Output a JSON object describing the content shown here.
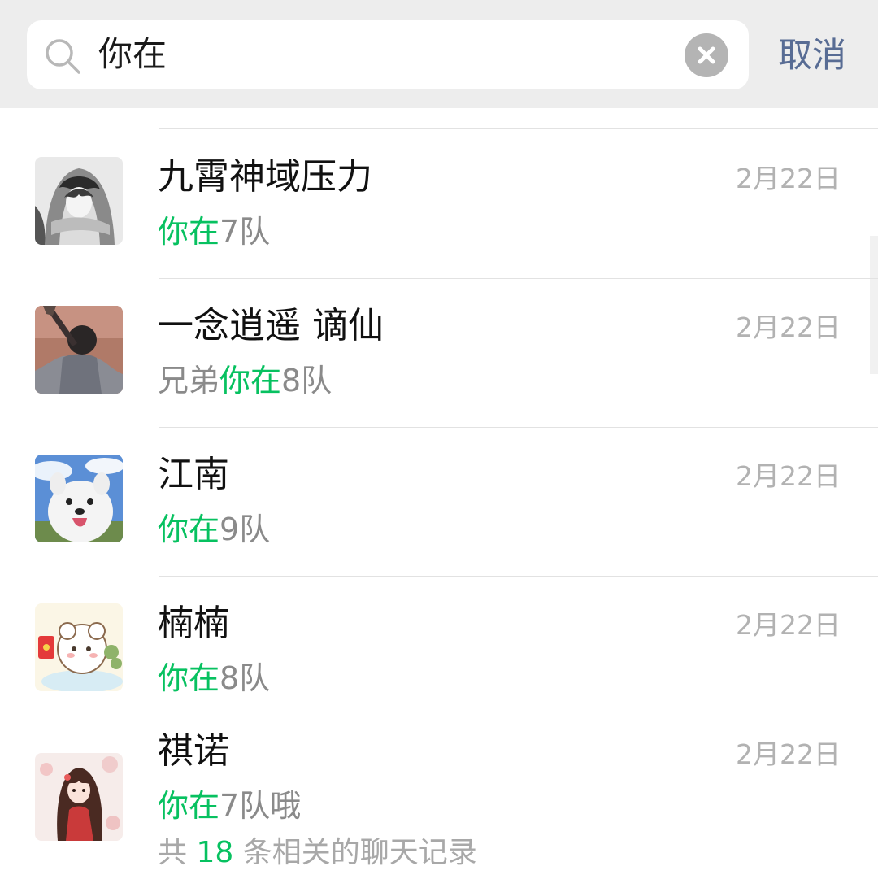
{
  "search": {
    "query": "你在",
    "cancel_label": "取消",
    "icon": "search-icon",
    "clear_icon": "clear-icon"
  },
  "results": [
    {
      "name": "九霄神域压力",
      "date": "2月22日",
      "snippet_before": "",
      "snippet_match": "你在",
      "snippet_after": "7队"
    },
    {
      "name": "一念逍遥 谪仙",
      "date": "2月22日",
      "snippet_before": "兄弟",
      "snippet_match": "你在",
      "snippet_after": "8队"
    },
    {
      "name": "江南",
      "date": "2月22日",
      "snippet_before": "",
      "snippet_match": "你在",
      "snippet_after": "9队"
    },
    {
      "name": "楠楠",
      "date": "2月22日",
      "snippet_before": "",
      "snippet_match": "你在",
      "snippet_after": "8队"
    },
    {
      "name": "祺诺",
      "date": "2月22日",
      "snippet_before": "",
      "snippet_match": "你在",
      "snippet_after": "7队哦",
      "more_prefix": "共 ",
      "more_count": "18",
      "more_suffix": " 条相关的聊天记录"
    }
  ],
  "colors": {
    "highlight": "#07c160",
    "cancel": "#586c94",
    "date": "#b2b2b2",
    "background": "#ededed"
  }
}
